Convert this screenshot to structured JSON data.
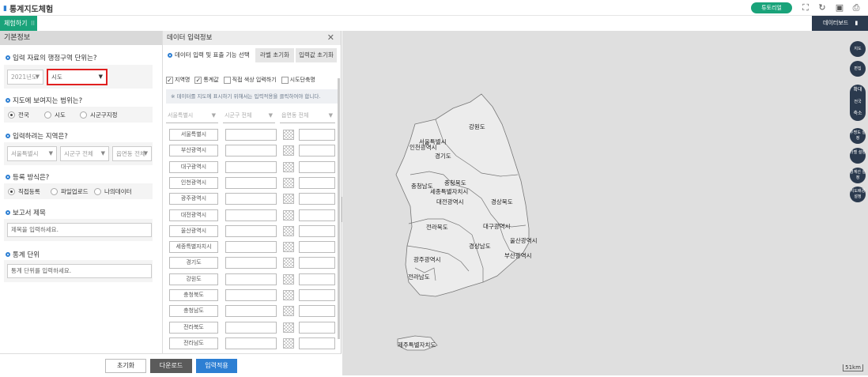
{
  "app": {
    "title": "통계지도체험"
  },
  "header": {
    "tutorial_label": "튜토리얼",
    "experience_tab": "체험하기",
    "dashboard_label": "데이터보드"
  },
  "left_panel": {
    "title": "기본정보",
    "q1": {
      "label": "입력 자료의 행정구역 단위는?",
      "year_value": "2021년도",
      "unit_value": "시도"
    },
    "q2": {
      "label": "지도에 보여지는 범위는?",
      "options": [
        "전국",
        "시도",
        "시군구지정"
      ],
      "selected": "전국"
    },
    "q3": {
      "label": "입력하려는 지역은?",
      "sido_placeholder": "서울특별시",
      "sigungu_placeholder": "시군구 전체",
      "emd_placeholder": "읍면동 전체"
    },
    "q4": {
      "label": "등록 방식은?",
      "options": [
        "직접등록",
        "파일업로드",
        "나의데이터"
      ],
      "selected": "직접등록"
    },
    "q5": {
      "label": "보고서 제목",
      "placeholder": "제목을 입력하세요."
    },
    "q6": {
      "label": "통계 단위",
      "placeholder": "통계 단위를 입력하세요."
    }
  },
  "bottom": {
    "reset": "초기화",
    "download": "다운로드",
    "apply": "입력적용"
  },
  "data_panel": {
    "title": "데이터 입력정보",
    "section_label": "데이터 입력 및 표출 기능 선택",
    "btn_label_reset": "라벨 초기화",
    "btn_input_reset": "입력값 초기화",
    "checks": [
      {
        "label": "지역명",
        "checked": true
      },
      {
        "label": "통계값",
        "checked": true
      },
      {
        "label": "직접 색상 입력하기",
        "checked": false
      },
      {
        "label": "시도단축명",
        "checked": false
      }
    ],
    "note": "※ 데이터를 지도에 표시하기 위해서는 입력적용을 클릭하여야 합니다.",
    "filters": [
      "서울특별시",
      "시군구 전체",
      "읍면동 전체"
    ],
    "rows": [
      "서울특별시",
      "부산광역시",
      "대구광역시",
      "인천광역시",
      "광주광역시",
      "대전광역시",
      "울산광역시",
      "세종특별자치시",
      "경기도",
      "강원도",
      "충청북도",
      "충청남도",
      "전라북도",
      "전라남도"
    ]
  },
  "map": {
    "labels": [
      "강원도",
      "서울특별시",
      "인천광역시",
      "경기도",
      "충청남도",
      "충청북도",
      "세종특별자치시",
      "대전광역시",
      "경상북도",
      "전라북도",
      "대구광역시",
      "울산광역시",
      "경상남도",
      "부산광역시",
      "광주광역시",
      "전라남도",
      "제주특별자치도"
    ],
    "tools": [
      "지도",
      "편집",
      "확대",
      "전국",
      "축소",
      "투명도 설정",
      "라벨 설정",
      "경계선 설정",
      "지도배경 설정"
    ],
    "scale": "51km"
  }
}
